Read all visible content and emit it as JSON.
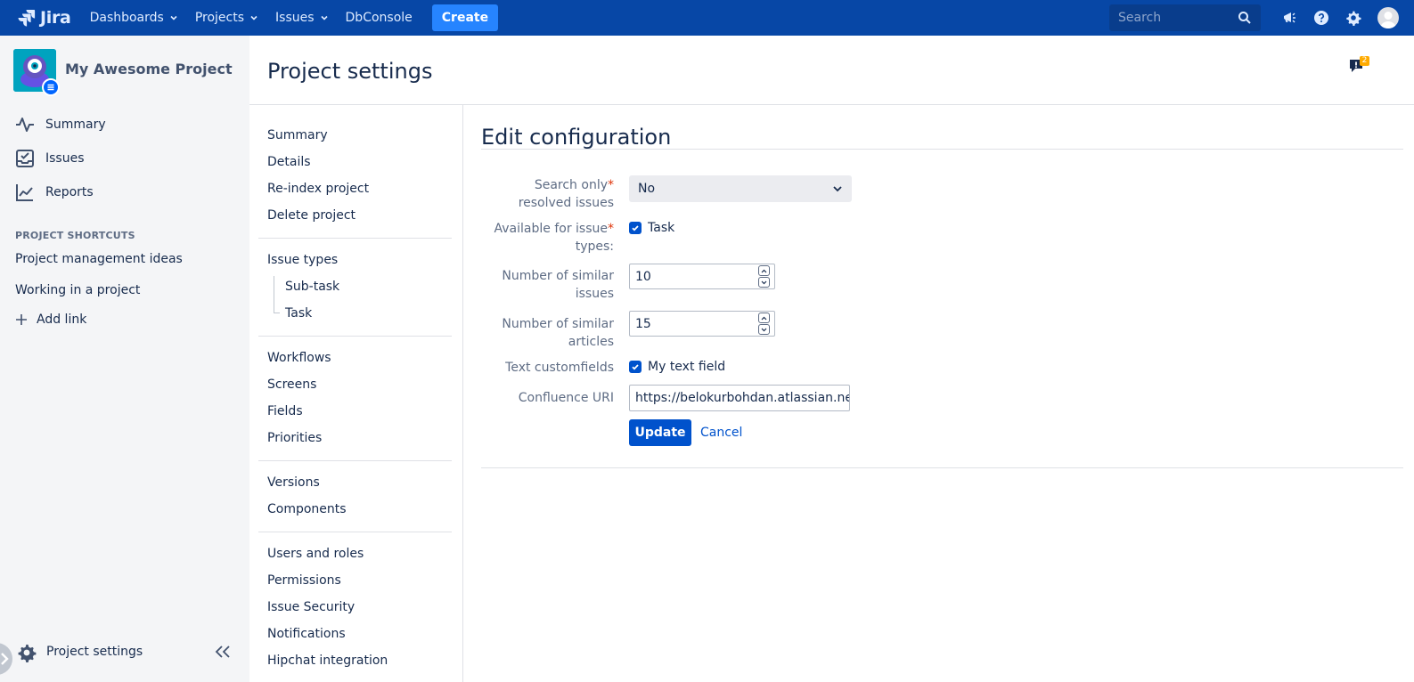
{
  "topnav": {
    "logo_text": "Jira",
    "items": [
      {
        "label": "Dashboards"
      },
      {
        "label": "Projects"
      },
      {
        "label": "Issues"
      },
      {
        "label": "DbConsole"
      }
    ],
    "create_label": "Create",
    "search_placeholder": "Search"
  },
  "sidebar": {
    "project_name": "My Awesome Project",
    "links": [
      {
        "label": "Summary",
        "icon": "activity-icon"
      },
      {
        "label": "Issues",
        "icon": "issues-icon"
      },
      {
        "label": "Reports",
        "icon": "reports-icon"
      }
    ],
    "shortcuts_title": "PROJECT SHORTCUTS",
    "shortcuts": [
      {
        "label": "Project management ideas"
      },
      {
        "label": "Working in a project"
      }
    ],
    "add_link_label": "Add link",
    "settings_label": "Project settings"
  },
  "header": {
    "title": "Project settings",
    "feedback_count": "2"
  },
  "settings_nav": {
    "group1": [
      "Summary",
      "Details",
      "Re-index project",
      "Delete project"
    ],
    "issue_types": "Issue types",
    "issue_type_children": [
      "Sub-task",
      "Task"
    ],
    "group3": [
      "Workflows",
      "Screens",
      "Fields",
      "Priorities"
    ],
    "group4": [
      "Versions",
      "Components"
    ],
    "group5": [
      "Users and roles",
      "Permissions",
      "Issue Security",
      "Notifications",
      "Hipchat integration"
    ]
  },
  "form": {
    "title": "Edit configuration",
    "search_resolved": {
      "label_line1": "Search only",
      "label_line2": "resolved issues",
      "value": "No"
    },
    "issue_types": {
      "label_line1": "Available for issue",
      "label_line2": "types:",
      "option": "Task"
    },
    "similar_issues": {
      "label_line1": "Number of similar",
      "label_line2": "issues",
      "value": "10"
    },
    "similar_articles": {
      "label_line1": "Number of similar",
      "label_line2": "articles",
      "value": "15"
    },
    "text_customfields": {
      "label": "Text customfields",
      "option": "My text field"
    },
    "confluence_uri": {
      "label": "Confluence URI",
      "value": "https://belokurbohdan.atlassian.net/wiki"
    },
    "update_label": "Update",
    "cancel_label": "Cancel",
    "required_mark": "*"
  },
  "colors": {
    "nav_bg": "#0747a6",
    "primary": "#0052cc",
    "create": "#2684ff",
    "required": "#de350b"
  }
}
